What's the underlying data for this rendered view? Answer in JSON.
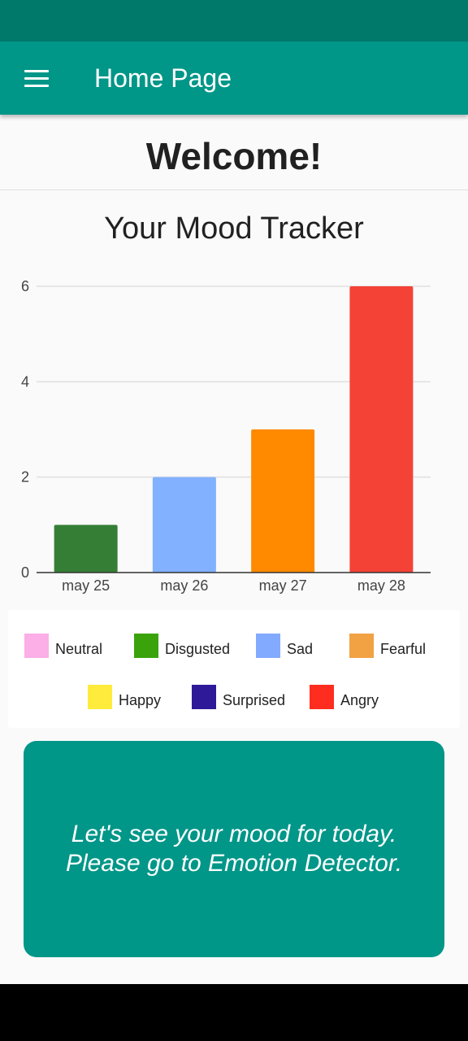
{
  "app_bar": {
    "title": "Home Page",
    "menu_icon": "menu-icon"
  },
  "welcome": "Welcome!",
  "chart_data": {
    "type": "bar",
    "title": "Your Mood Tracker",
    "categories": [
      "may 25",
      "may 26",
      "may 27",
      "may 28"
    ],
    "values": [
      1,
      2,
      3,
      6
    ],
    "bar_colors": [
      "#357e35",
      "#82b1ff",
      "#ff8a00",
      "#f44336"
    ],
    "ylim": [
      0,
      6
    ],
    "yticks": [
      0,
      2,
      4,
      6
    ],
    "grid": true
  },
  "legend": [
    {
      "label": "Neutral",
      "color": "#fcaee6"
    },
    {
      "label": "Disgusted",
      "color": "#3aa30b"
    },
    {
      "label": "Sad",
      "color": "#82aaff"
    },
    {
      "label": "Fearful",
      "color": "#f2a143"
    },
    {
      "label": "Happy",
      "color": "#ffeb3b"
    },
    {
      "label": "Surprised",
      "color": "#2e1a98"
    },
    {
      "label": "Angry",
      "color": "#ff2d1f"
    }
  ],
  "cta": {
    "line1": "Let's see your mood for today.",
    "line2": "Please go to Emotion Detector."
  }
}
